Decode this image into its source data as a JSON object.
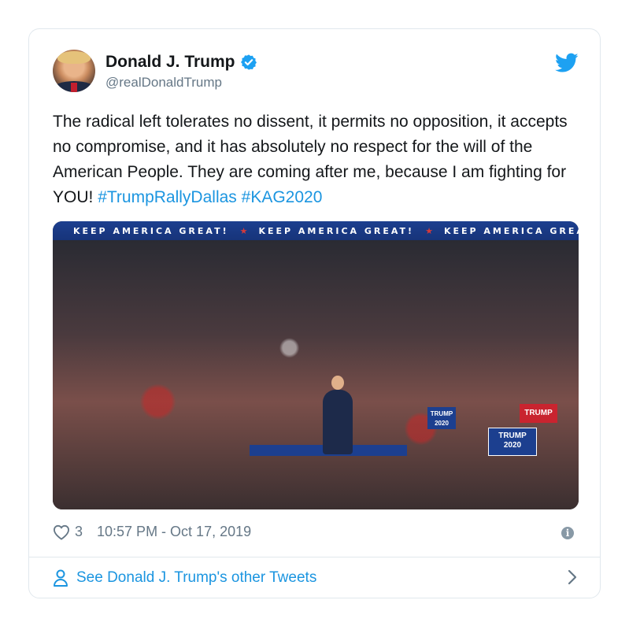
{
  "tweet": {
    "author_name": "Donald J. Trump",
    "handle": "@realDonaldTrump",
    "text_plain": "The radical left tolerates no dissent, it permits no opposition, it accepts no compromise, and it has absolutely no respect for the will of the American People. They are coming after me, because I am fighting for YOU! ",
    "hashtags": [
      "#TrumpRallyDallas",
      "#KAG2020"
    ],
    "likes": "3",
    "timestamp": "10:57 PM - Oct 17, 2019"
  },
  "media": {
    "banner_text": "KEEP AMERICA GREAT!",
    "signs": [
      "TRUMP",
      "TRUMP 2020",
      "TRUMP 2020"
    ]
  },
  "footer": {
    "link_label": "See Donald J. Trump's other Tweets"
  },
  "icons": {
    "verified": "verified-badge-icon",
    "twitter": "twitter-bird-icon",
    "like": "heart-icon",
    "info": "info-icon",
    "profile": "person-icon",
    "next": "chevron-right-icon"
  },
  "colors": {
    "link": "#1b95e0",
    "muted": "#657786",
    "border": "#e1e8ed"
  }
}
